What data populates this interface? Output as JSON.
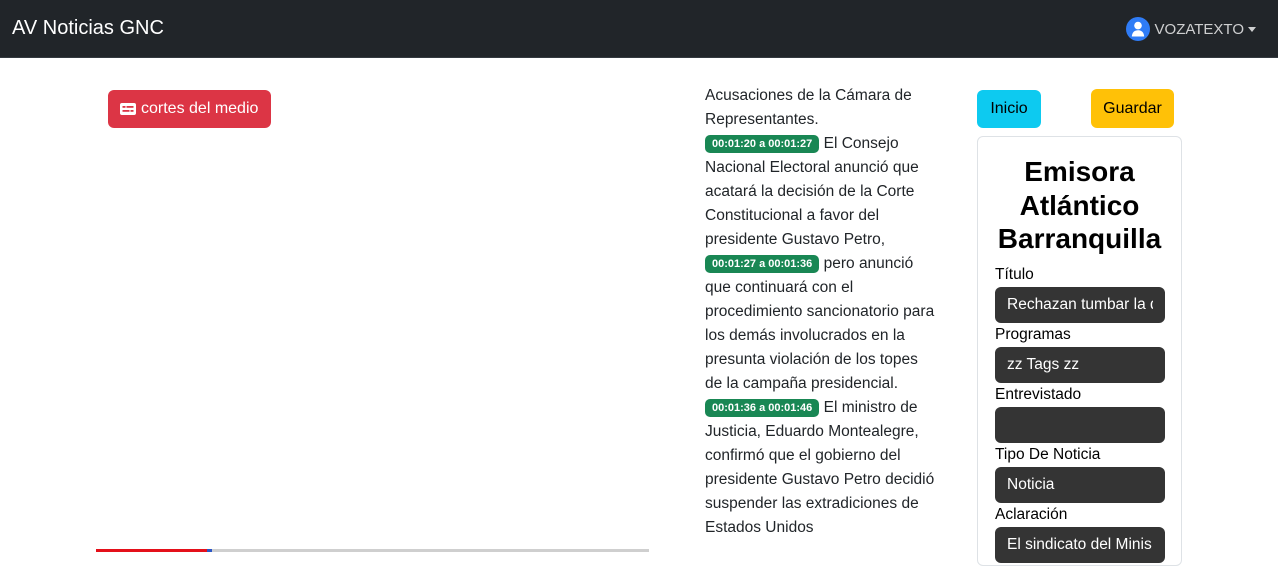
{
  "navbar": {
    "brand": "AV Noticias GNC",
    "user": "VOZATEXTO"
  },
  "toolbar": {
    "cortes_label": "cortes del medio",
    "inicio_label": "Inicio",
    "guardar_label": "Guardar"
  },
  "player": {
    "progress_fraction": 0.2
  },
  "transcript": {
    "intro": "Acusaciones de la Cámara de Representantes.",
    "segments": [
      {
        "time": "00:01:20 a 00:01:27",
        "text": "El Consejo Nacional Electoral anunció que acatará la decisión de la Corte Constitucional a favor del presidente Gustavo Petro,"
      },
      {
        "time": "00:01:27 a 00:01:36",
        "text": "pero anunció que continuará con el procedimiento sancionatorio para los demás involucrados en la presunta violación de los topes de la campaña presidencial."
      },
      {
        "time": "00:01:36 a 00:01:46",
        "text": "El ministro de Justicia, Eduardo Montealegre, confirmó que el gobierno del presidente Gustavo Petro decidió suspender las extradiciones de Estados Unidos"
      }
    ]
  },
  "panel": {
    "station": "Emisora Atlántico Barranquilla",
    "fields": [
      {
        "label": "Título",
        "value": "Rechazan tumbar la d"
      },
      {
        "label": "Programas",
        "value": "zz Tags zz"
      },
      {
        "label": "Entrevistado",
        "value": ""
      },
      {
        "label": "Tipo De Noticia",
        "value": "Noticia"
      },
      {
        "label": "Aclaración",
        "value": "El sindicato del Minis"
      }
    ]
  },
  "colors": {
    "navbar": "#212529",
    "danger": "#dc3545",
    "info": "#0dcaf0",
    "warning": "#ffc107",
    "success": "#198754",
    "input_bg": "#343434"
  }
}
